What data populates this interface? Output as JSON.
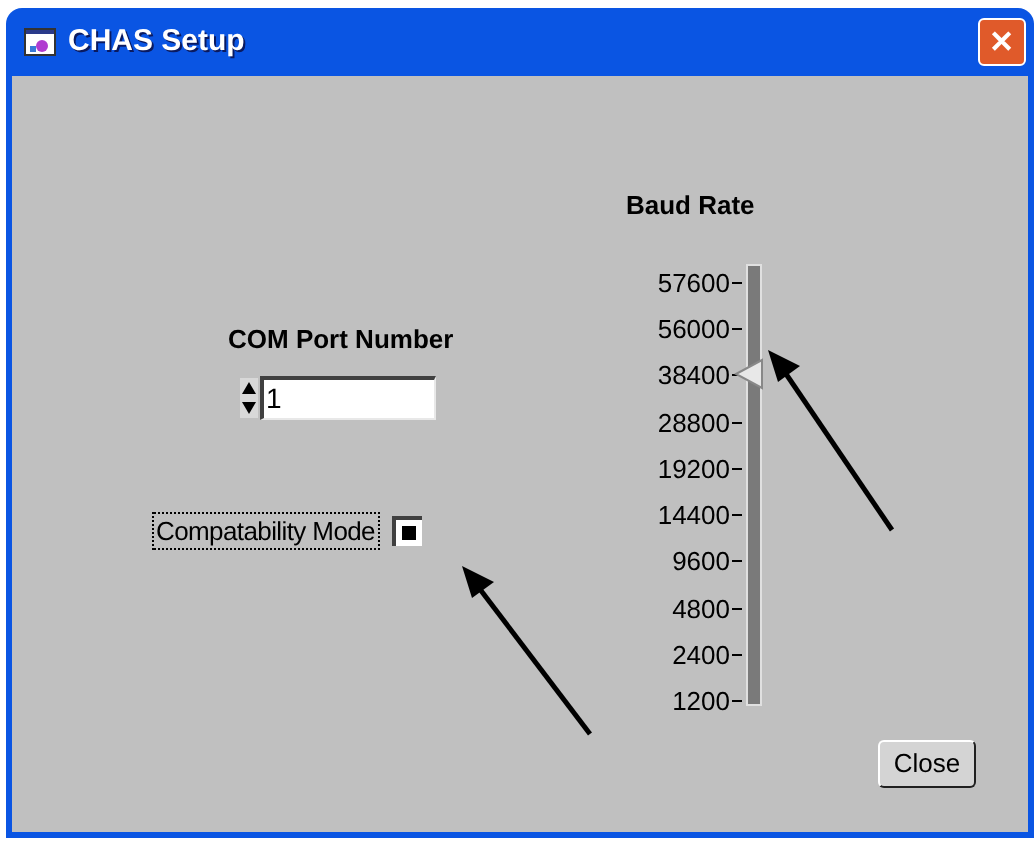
{
  "window": {
    "title": "CHAS Setup",
    "close_glyph": "✕"
  },
  "com_port": {
    "label": "COM Port Number",
    "value": "1"
  },
  "compat": {
    "label": "Compatability Mode",
    "checked": true
  },
  "baud": {
    "label": "Baud Rate",
    "ticks": [
      "57600",
      "56000",
      "38400",
      "28800",
      "19200",
      "14400",
      "9600",
      "4800",
      "2400",
      "1200"
    ],
    "level": 0.778
  },
  "buttons": [
    "Close"
  ]
}
